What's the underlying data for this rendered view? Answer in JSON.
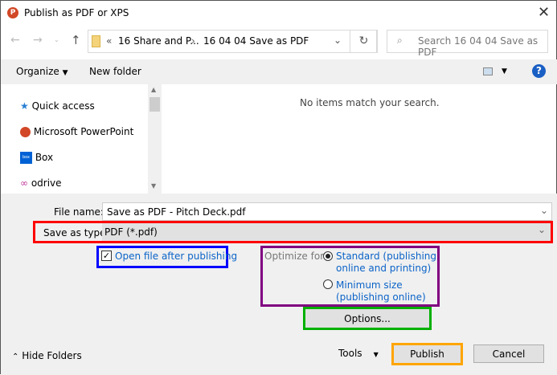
{
  "window": {
    "title": "Publish as PDF or XPS",
    "app_icon": "powerpoint-icon"
  },
  "address": {
    "prefix": "«",
    "crumbs": [
      "16 Share and P...",
      "16 04 04 Save as PDF"
    ]
  },
  "search": {
    "placeholder": "Search 16 04 04 Save as PDF"
  },
  "toolbar": {
    "organize": "Organize",
    "new_folder": "New folder"
  },
  "nav": {
    "items": [
      {
        "label": "Quick access",
        "icon": "star-icon"
      },
      {
        "label": "Microsoft PowerPoint",
        "icon": "powerpoint-icon"
      },
      {
        "label": "Box",
        "icon": "box-icon"
      },
      {
        "label": "odrive",
        "icon": "infinity-icon"
      }
    ]
  },
  "content": {
    "empty_text": "No items match your search."
  },
  "form": {
    "file_name_label": "File name:",
    "file_name_value": "Save as PDF - Pitch Deck.pdf",
    "save_type_label": "Save as type:",
    "save_type_value": "PDF (*.pdf)",
    "open_after_label": "Open file after publishing",
    "open_after_checked": true,
    "optimize_label": "Optimize for:",
    "optimize_options": [
      {
        "line1": "Standard (publishing",
        "line2": "online and printing)",
        "selected": true
      },
      {
        "line1": "Minimum size",
        "line2": "(publishing online)",
        "selected": false
      }
    ],
    "options_button": "Options..."
  },
  "footer": {
    "hide_folders": "Hide Folders",
    "tools": "Tools",
    "publish": "Publish",
    "cancel": "Cancel"
  },
  "highlights": {
    "save_type": "#ff0000",
    "open_after": "#0000ff",
    "optimize": "#800080",
    "options": "#00b000",
    "publish": "#ffa500"
  }
}
